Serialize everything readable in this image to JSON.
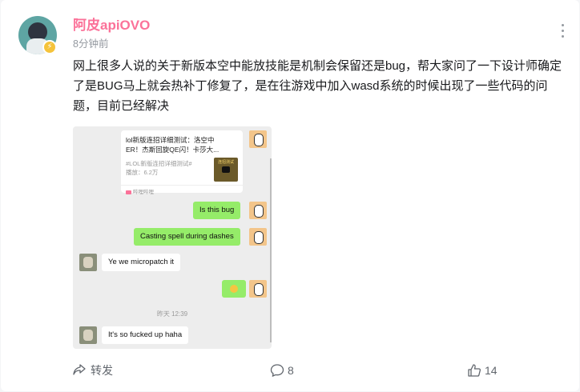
{
  "post": {
    "author": "阿皮apiOVO",
    "time": "8分钟前",
    "text": "网上很多人说的关于新版本空中能放技能是机制会保留还是bug，帮大家问了一下设计师确定了是BUG马上就会热补丁修复了，是在往游戏中加入wasd系统的时候出现了一些代码的问题，目前已经解决"
  },
  "chat": {
    "share_card": {
      "title": "lol新版连招详细测试：洛空中ER！杰斯回旋QE闪！卡莎大...",
      "tag": "#LOL新版连招详细测试#",
      "plays": "播放：6.2万",
      "thumb_text": "连招测试",
      "source": "哔哩哔哩"
    },
    "messages": [
      {
        "text": "Is this bug",
        "side": "me"
      },
      {
        "text": "Casting spell during dashes",
        "side": "me"
      },
      {
        "text": "Ye we micropatch it",
        "side": "them"
      },
      {
        "text": "It's so fucked up haha",
        "side": "them"
      }
    ],
    "timestamp": "昨天 12:39"
  },
  "actions": {
    "share_label": "转发",
    "comment_count": "8",
    "like_count": "14"
  },
  "colors": {
    "author": "#fb7299",
    "wechat_green": "#95ec69",
    "muted": "#9499a0"
  }
}
